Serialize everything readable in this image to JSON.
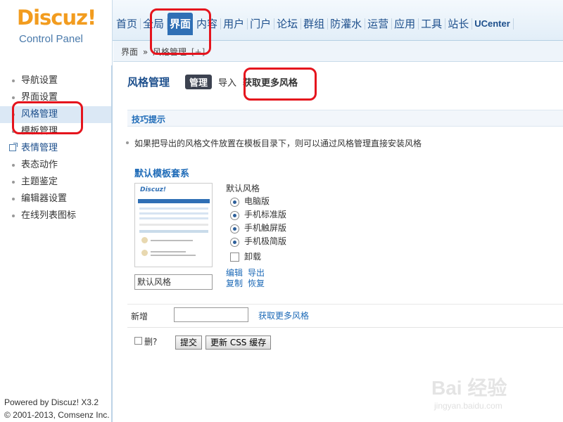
{
  "logo": {
    "brand": "Discuz!",
    "subtitle": "Control Panel"
  },
  "nav": [
    {
      "label": "首页"
    },
    {
      "label": "全局"
    },
    {
      "label": "界面",
      "active": true
    },
    {
      "label": "内容"
    },
    {
      "label": "用户"
    },
    {
      "label": "门户"
    },
    {
      "label": "论坛"
    },
    {
      "label": "群组"
    },
    {
      "label": "防灌水"
    },
    {
      "label": "运营"
    },
    {
      "label": "应用"
    },
    {
      "label": "工具"
    },
    {
      "label": "站长"
    },
    {
      "label": "UCenter"
    }
  ],
  "breadcrumb": {
    "section": "界面",
    "separator": "»",
    "page": "风格管理",
    "add": "[+]"
  },
  "sidebar": {
    "items": [
      {
        "label": "导航设置"
      },
      {
        "label": "界面设置"
      },
      {
        "label": "风格管理",
        "active": true
      },
      {
        "label": "模板管理"
      },
      {
        "label": "表情管理",
        "external": true
      },
      {
        "label": "表态动作"
      },
      {
        "label": "主题鉴定"
      },
      {
        "label": "编辑器设置"
      },
      {
        "label": "在线列表图标"
      }
    ]
  },
  "footer": {
    "powered": "Powered by Discuz! X3.2",
    "copyright": "© 2001-2013, Comsenz Inc."
  },
  "subnav": {
    "title": "风格管理",
    "tab_manage": "管理",
    "tab_import": "导入",
    "tab_more": "获取更多风格"
  },
  "tips": {
    "heading": "技巧提示",
    "line": "如果把导出的风格文件放置在模板目录下，则可以通过风格管理直接安装风格"
  },
  "package": {
    "title": "默认模板套系",
    "thumb_logo": "Discuz!",
    "style_name": "默认风格",
    "options_label": "默认风格",
    "options": [
      "电脑版",
      "手机标准版",
      "手机触屏版",
      "手机极简版"
    ],
    "uninstall": "卸载",
    "links": {
      "edit": "编辑",
      "export": "导出",
      "copy": "复制",
      "restore": "恢复"
    }
  },
  "new_row": {
    "label": "新增",
    "more_link": "获取更多风格"
  },
  "actions": {
    "delete_label": "删?",
    "submit": "提交",
    "update_css": "更新 CSS 缓存"
  },
  "watermark": {
    "text": "Bai 经验",
    "url": "jingyan.baidu.com"
  },
  "colors": {
    "accent": "#2f6fb5",
    "brand": "#f29c1f",
    "annotation": "#e5141d"
  }
}
